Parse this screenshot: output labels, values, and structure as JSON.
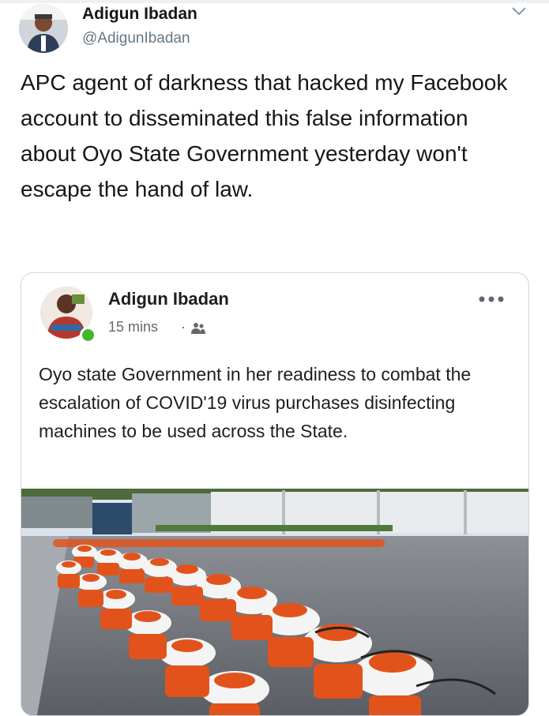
{
  "tweet": {
    "author_name": "Adigun Ibadan",
    "author_handle": "@AdigunIbadan",
    "text": "APC agent of darkness that hacked my Facebook account to disseminated this false information about Oyo State Government yesterday won't escape the hand of law."
  },
  "embedded_post": {
    "author_name": "Adigun Ibadan",
    "time": "15 mins",
    "separator": "·",
    "text": "Oyo state Government in her readiness to combat the escalation of COVID'19 virus purchases disinfecting machines to be used across the State.",
    "photo_subject": "rows of white and orange disinfecting sprayer machines"
  },
  "icons": {
    "menu": "chevron-down-icon",
    "audience": "friends-icon",
    "options": "more-options-icon"
  },
  "colors": {
    "handle_gray": "#657786",
    "online_green": "#42b72a",
    "sprayer_orange": "#e2531c"
  }
}
